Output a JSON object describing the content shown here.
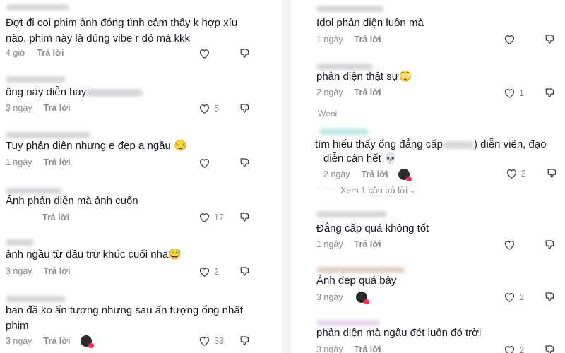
{
  "reply_label": "Trả lời",
  "left": [
    {
      "text": "Đợt đi coi phim ảnh đóng tình cảm thấy k hợp xíu nào, phim này là đúng vibe r đó má kkk",
      "time": "4 giờ",
      "likes": ""
    },
    {
      "text": "ông này diễn hay",
      "time": "3 ngày",
      "likes": "5"
    },
    {
      "text": "Tuy phản diện nhưng e đẹp a ngầu 😏",
      "time": "1 ngày",
      "likes": ""
    },
    {
      "text": "Ảnh phản diện mà ảnh cuốn",
      "time": "",
      "likes": "17"
    },
    {
      "text": "ảnh ngầu từ đầu trừ khúc cuối nha😅",
      "time": "3 ngày",
      "likes": "2"
    },
    {
      "text": "ban đầ ko ấn tượng nhưng sau ấn tượng ổng nhất phim",
      "time": "3 ngày",
      "likes": "33"
    }
  ],
  "right": [
    {
      "text": "Idol phản diện luôn mà",
      "time": "1 ngày",
      "likes": ""
    },
    {
      "text": "phản diện thật sự😳",
      "time": "2 ngày",
      "likes": "1"
    },
    {
      "username": "Weni",
      "text_a": "tìm hiểu thấy ổng đẳng cấp",
      "text_b": ") diễn viên, đạo",
      "text_c": "diễn cân hết 💀",
      "time": "2 ngày",
      "likes": "2"
    },
    {
      "text": "Đẳng cấp quá không tốt",
      "time": "1 ngày",
      "likes": ""
    },
    {
      "text": "Ảnh đẹp quá bây",
      "time": "3 ngày",
      "likes": "2"
    },
    {
      "text": "phản diện mà ngầu đét luôn đó trời",
      "time": "3 ngày",
      "likes": "2"
    }
  ],
  "view_replies": "Xem 1 câu trả lời",
  "icons": {
    "like": "heart-outline-icon",
    "dislike": "thumbs-down-icon",
    "avatar": "author-avatar-icon"
  }
}
